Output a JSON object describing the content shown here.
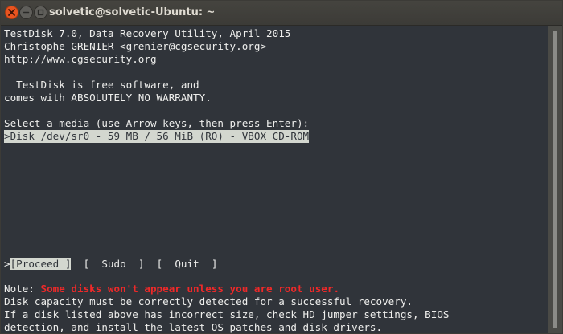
{
  "window": {
    "title": "solvetic@solvetic-Ubuntu: ~",
    "buttons": {
      "close_icon": "close-icon",
      "minimize_icon": "minimize-icon",
      "maximize_icon": "maximize-icon"
    }
  },
  "terminal": {
    "header": {
      "line1": "TestDisk 7.0, Data Recovery Utility, April 2015",
      "line2": "Christophe GRENIER <grenier@cgsecurity.org>",
      "line3": "http://www.cgsecurity.org"
    },
    "intro": {
      "line1": "  TestDisk is free software, and",
      "line2": "comes with ABSOLUTELY NO WARRANTY."
    },
    "media_prompt": "Select a media (use Arrow keys, then press Enter):",
    "media_list": [
      ">Disk /dev/sr0 - 59 MB / 56 MiB (RO) - VBOX CD-ROM"
    ],
    "menu": {
      "selector": ">",
      "proceed": "[Proceed ]",
      "sudo": "[  Sudo  ]",
      "quit": "[  Quit  ]"
    },
    "note": {
      "prefix": "Note: ",
      "warning": "Some disks won't appear unless you are root user.",
      "line2": "Disk capacity must be correctly detected for a successful recovery.",
      "line3": "If a disk listed above has incorrect size, check HD jumper settings, BIOS",
      "line4": "detection, and install the latest OS patches and disk drivers."
    }
  },
  "colors": {
    "terminal_bg": "#30343a",
    "text": "#eeeeec",
    "highlight_bg": "#d3d7cf",
    "warning": "#ef2929",
    "close_button": "#e95420"
  }
}
